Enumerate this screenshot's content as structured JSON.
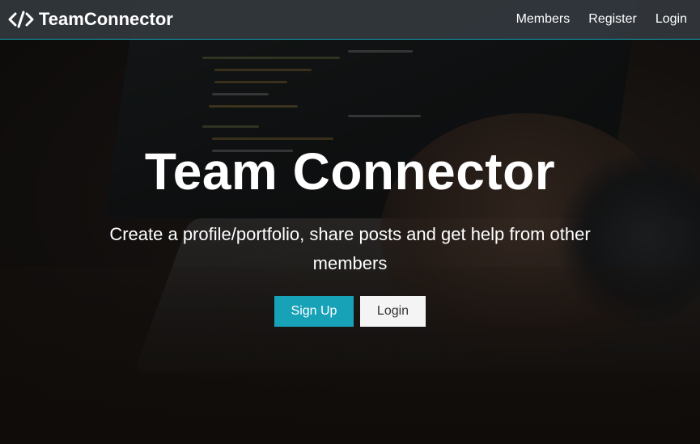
{
  "navbar": {
    "brand_icon": "code-icon",
    "brand_text": "TeamConnector",
    "links": [
      "Members",
      "Register",
      "Login"
    ]
  },
  "hero": {
    "title": "Team Connector",
    "lead": "Create a profile/portfolio, share posts and get help from other members",
    "signup_label": "Sign Up",
    "login_label": "Login"
  },
  "colors": {
    "accent": "#17a2b8",
    "navbar": "#343a40",
    "light_button": "#f4f4f4"
  }
}
